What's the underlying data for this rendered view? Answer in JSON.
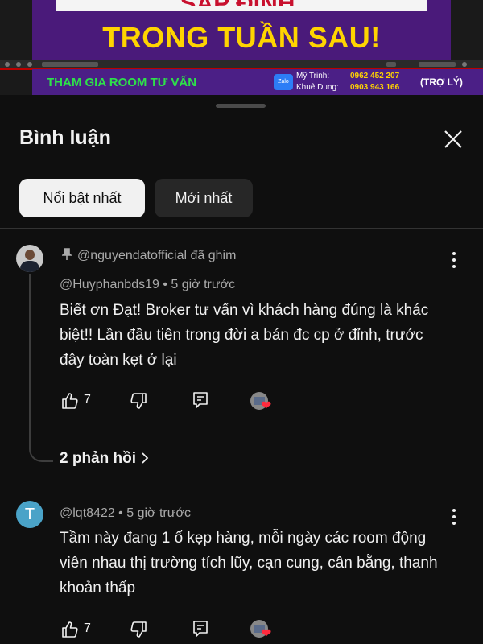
{
  "video": {
    "banner_fragment": "SẮP ĐỈNH",
    "headline": "TRONG TUẦN SAU!",
    "promo": {
      "cta": "THAM GIA ROOM TƯ VẤN",
      "zalo_label": "Zalo",
      "contact1_name": "Mỹ Trinh:",
      "contact1_phone": "0962 452 207",
      "contact2_name": "Khuê Dung:",
      "contact2_phone": "0903 943 166",
      "assistant": "(TRỢ LÝ)"
    }
  },
  "panel": {
    "title": "Bình luận",
    "filters": [
      "Nổi bật nhất",
      "Mới nhất"
    ]
  },
  "comments": [
    {
      "pinned_by": "@nguyendatofficial đã ghim",
      "meta": "@Huyphanbds19 • 5 giờ trước",
      "text": "Biết ơn Đạt! Broker tư vấn vì khách hàng đúng là khác biệt!! Lần đầu tiên trong đời a bán đc cp ở đỉnh, trước đây toàn kẹt ở lại",
      "likes": "7",
      "replies": "2 phản hồi"
    },
    {
      "avatar_letter": "T",
      "meta": "@lqt8422 • 5 giờ trước",
      "text": "Tầm này đang 1 ổ kẹp hàng, mỗi ngày các room động viên nhau thị trường tích lũy, cạn cung, cân bằng, thanh khoản thấp",
      "likes": "7"
    }
  ],
  "icons": [
    "close-icon",
    "pin-icon",
    "like-icon",
    "dislike-icon",
    "reply-icon",
    "more-vert-icon",
    "chevron-right-icon",
    "creator-heart-icon"
  ],
  "colors": {
    "background": "#0f0f0f",
    "headline": "#ffd400",
    "promo_bg": "#4b1f86",
    "promo_cta": "#2ee04a",
    "heart": "#ff2a3d",
    "avatar_t": "#4aa3c8"
  }
}
